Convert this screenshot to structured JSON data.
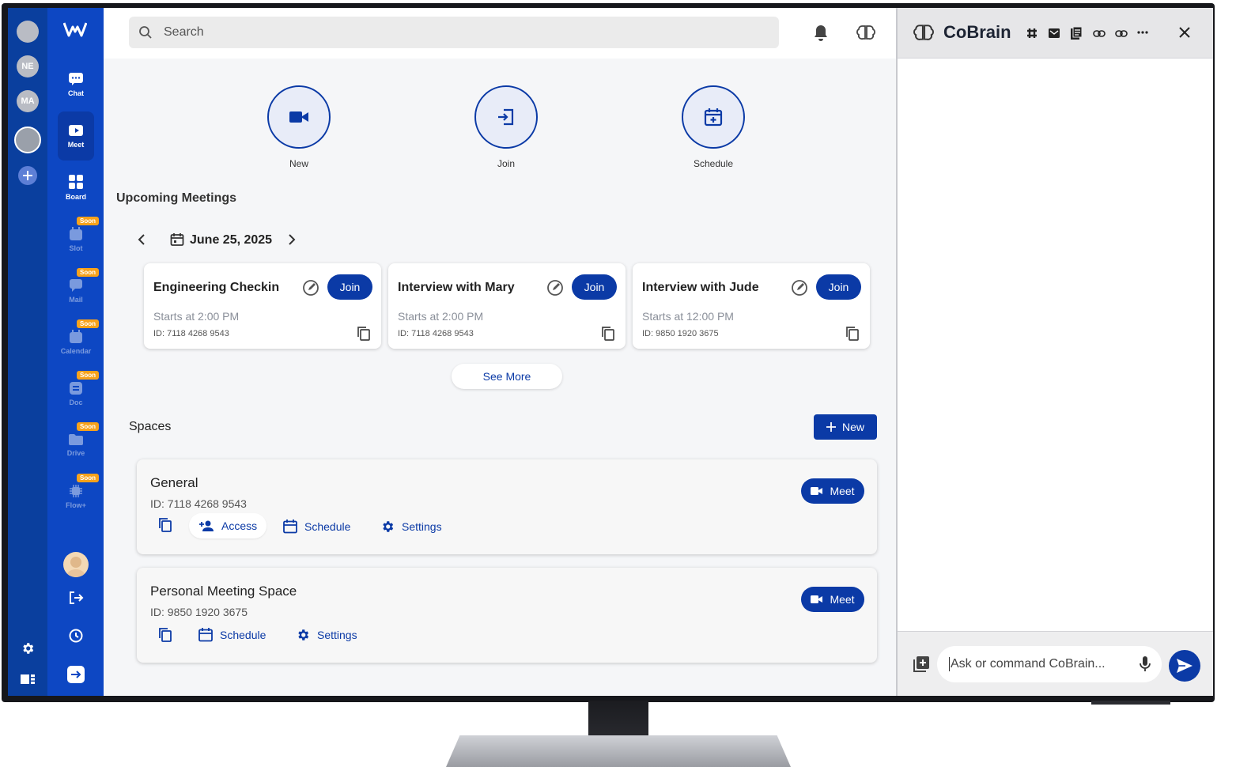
{
  "workspaces": [
    "NE",
    "MA"
  ],
  "nav": [
    {
      "label": "Chat",
      "soon": false
    },
    {
      "label": "Meet",
      "soon": false
    },
    {
      "label": "Board",
      "soon": false
    },
    {
      "label": "Slot",
      "soon": true
    },
    {
      "label": "Mail",
      "soon": true
    },
    {
      "label": "Calendar",
      "soon": true
    },
    {
      "label": "Doc",
      "soon": true
    },
    {
      "label": "Drive",
      "soon": true
    },
    {
      "label": "Flow+",
      "soon": true
    }
  ],
  "soon_badge": "Soon",
  "search": {
    "placeholder": "Search"
  },
  "quick_actions": [
    {
      "label": "New",
      "icon": "video-camera-icon"
    },
    {
      "label": "Join",
      "icon": "join-icon"
    },
    {
      "label": "Schedule",
      "icon": "calendar-add-icon"
    }
  ],
  "upcoming": {
    "title": "Upcoming Meetings",
    "date": "June 25, 2025",
    "join_label": "Join",
    "meetings": [
      {
        "title": "Engineering Checkin",
        "starts": "Starts at 2:00 PM",
        "id": "ID: 7118 4268 9543"
      },
      {
        "title": "Interview with Mary",
        "starts": "Starts at 2:00 PM",
        "id": "ID: 7118 4268 9543"
      },
      {
        "title": "Interview with Jude",
        "starts": "Starts at 12:00 PM",
        "id": "ID: 9850 1920 3675"
      }
    ],
    "see_more": "See More"
  },
  "spaces": {
    "title": "Spaces",
    "new_label": "New",
    "meet_label": "Meet",
    "access_label": "Access",
    "schedule_label": "Schedule",
    "settings_label": "Settings",
    "items": [
      {
        "name": "General",
        "id": "ID: 7118 4268 9543"
      },
      {
        "name": "Personal Meeting Space",
        "id": "ID: 9850 1920 3675"
      }
    ]
  },
  "cobrain": {
    "title": "CoBrain",
    "input_placeholder": "Ask or command CoBrain..."
  },
  "colors": {
    "primary": "#0b3aa6",
    "rail": "#0d47c3",
    "soon": "#f7a21b"
  }
}
